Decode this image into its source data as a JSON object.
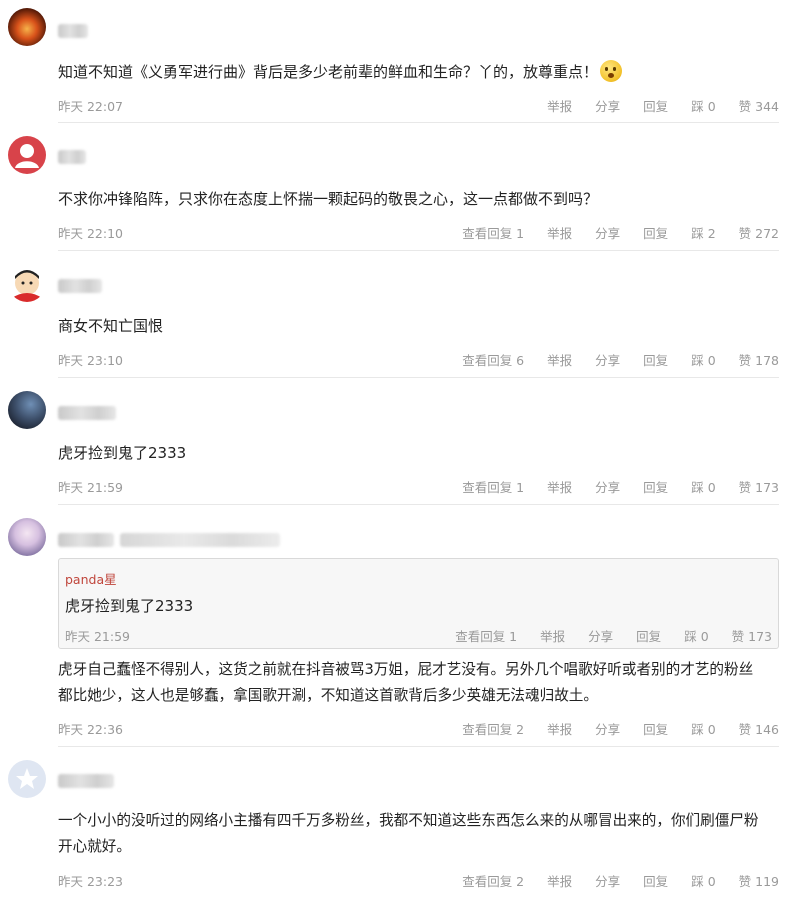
{
  "actions": {
    "report": "举报",
    "share": "分享",
    "reply": "回复",
    "dislike_prefix": "踩",
    "like_prefix": "赞"
  },
  "comments": [
    {
      "text": "知道不知道《义勇军进行曲》背后是多少老前辈的鲜血和生命？丫的，放尊重点！",
      "emoji": "grin-emoji",
      "time": "昨天 22:07",
      "view_replies": "",
      "dislikes": "0",
      "likes": "344"
    },
    {
      "text": "不求你冲锋陷阵，只求你在态度上怀揣一颗起码的敬畏之心，这一点都做不到吗？",
      "time": "昨天 22:10",
      "view_replies": "查看回复 1",
      "dislikes": "2",
      "likes": "272"
    },
    {
      "text": "商女不知亡国恨",
      "time": "昨天 23:10",
      "view_replies": "查看回复 6",
      "dislikes": "0",
      "likes": "178"
    },
    {
      "text": "虎牙捡到鬼了2333",
      "time": "昨天 21:59",
      "view_replies": "查看回复 1",
      "dislikes": "0",
      "likes": "173"
    },
    {
      "quote": {
        "user": "panda星",
        "text": "虎牙捡到鬼了2333",
        "time": "昨天 21:59",
        "view_replies": "查看回复 1",
        "dislikes": "0",
        "likes": "173"
      },
      "text_line1": "虎牙自己蠢怪不得别人，这货之前就在抖音被骂3万姐，屁才艺没有。另外几个唱歌好听或者别的才艺的粉丝",
      "text_line2": "都比她少，这人也是够蠢，拿国歌开涮，不知道这首歌背后多少英雄无法魂归故土。",
      "time": "昨天 22:36",
      "view_replies": "查看回复 2",
      "dislikes": "0",
      "likes": "146"
    },
    {
      "text_line1": "一个小小的没听过的网络小主播有四千万多粉丝，我都不知道这些东西怎么来的从哪冒出来的，你们刷僵尸粉",
      "text_line2": "开心就好。",
      "time": "昨天 23:23",
      "view_replies": "查看回复 2",
      "dislikes": "0",
      "likes": "119"
    }
  ],
  "colors": {
    "meta_gray": "#9a9a9a",
    "quote_user_red": "#c0463c",
    "quote_bg": "#f7f7f7"
  }
}
